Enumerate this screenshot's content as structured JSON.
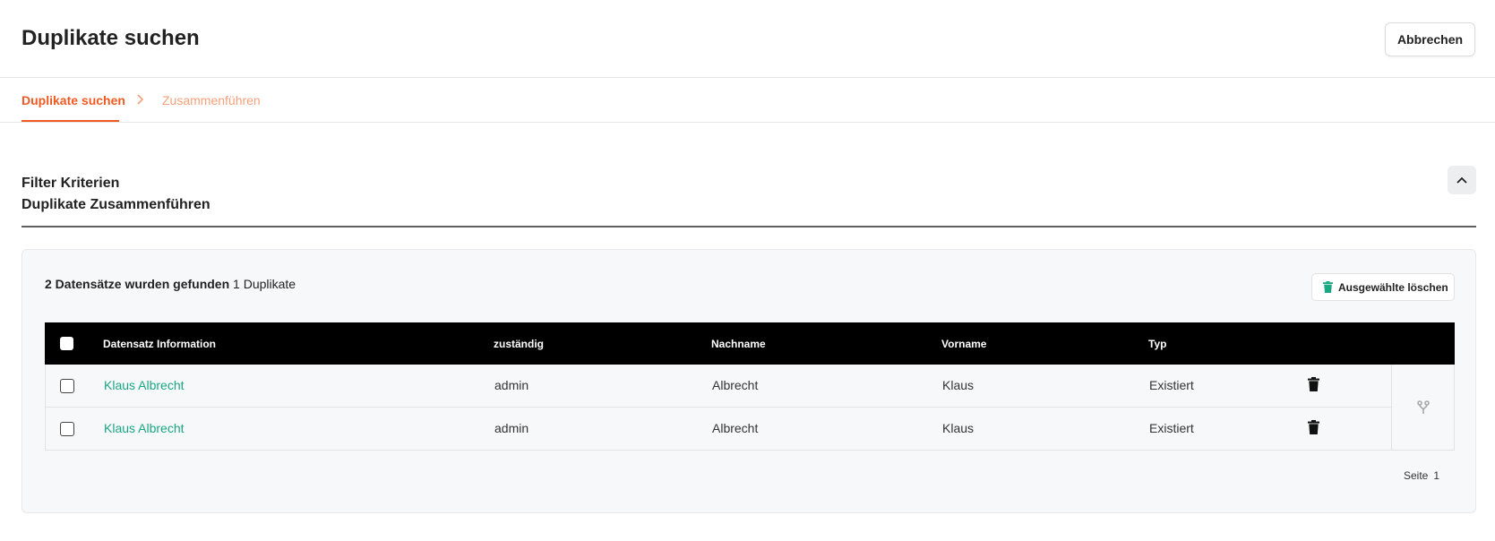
{
  "header": {
    "title": "Duplikate suchen",
    "cancel_label": "Abbrechen"
  },
  "steps": [
    {
      "label": "Duplikate suchen",
      "active": true
    },
    {
      "label": "Zusammenführen",
      "active": false
    }
  ],
  "section": {
    "title_1": "Filter Kriterien",
    "title_2": "Duplikate Zusammenführen"
  },
  "results": {
    "count_text": "2 Datensätze wurden gefunden",
    "duplicates_text": "1 Duplikate",
    "delete_selected_label": "Ausgewählte löschen"
  },
  "table": {
    "columns": [
      "Datensatz Information",
      "zuständig",
      "Nachname",
      "Vorname",
      "Typ"
    ],
    "rows": [
      {
        "info": "Klaus Albrecht",
        "zustaendig": "admin",
        "nachname": "Albrecht",
        "vorname": "Klaus",
        "typ": "Existiert"
      },
      {
        "info": "Klaus Albrecht",
        "zustaendig": "admin",
        "nachname": "Albrecht",
        "vorname": "Klaus",
        "typ": "Existiert"
      }
    ]
  },
  "pager": {
    "label": "Seite",
    "page": "1"
  },
  "icons": {
    "chevron_right": "chevron-right-icon",
    "chevron_up": "chevron-up-icon",
    "trash": "trash-icon",
    "merge": "merge-icon"
  },
  "colors": {
    "accent": "#f05a22",
    "accent_light": "#f5a07a",
    "link": "#1aa783",
    "header_bg": "#000000"
  }
}
